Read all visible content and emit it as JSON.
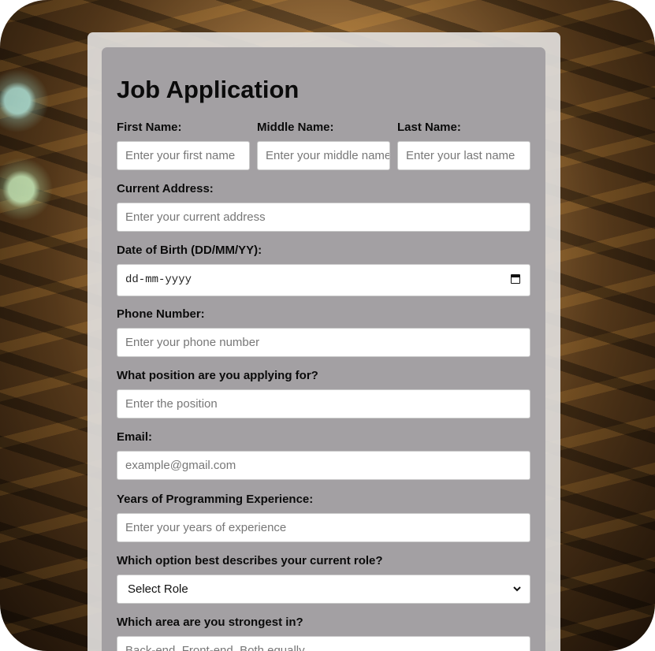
{
  "form": {
    "title": "Job Application",
    "first_name": {
      "label": "First Name:",
      "placeholder": "Enter your first name"
    },
    "middle_name": {
      "label": "Middle Name:",
      "placeholder": "Enter your middle name"
    },
    "last_name": {
      "label": "Last Name:",
      "placeholder": "Enter your last name"
    },
    "address": {
      "label": "Current Address:",
      "placeholder": "Enter your current address"
    },
    "dob": {
      "label": "Date of Birth (DD/MM/YY):",
      "value": "dd-mm-yyyy",
      "icon": "calendar-icon"
    },
    "phone": {
      "label": "Phone Number:",
      "placeholder": "Enter your phone number"
    },
    "position": {
      "label": "What position are you applying for?",
      "placeholder": "Enter the position"
    },
    "email": {
      "label": "Email:",
      "placeholder": "example@gmail.com"
    },
    "experience": {
      "label": "Years of Programming Experience:",
      "placeholder": "Enter your years of experience"
    },
    "role": {
      "label": "Which option best describes your current role?",
      "selected": "Select Role",
      "icon": "chevron-down-icon"
    },
    "strongest": {
      "label": "Which area are you strongest in?",
      "placeholder": "Back-end, Front-end, Both equally"
    }
  }
}
